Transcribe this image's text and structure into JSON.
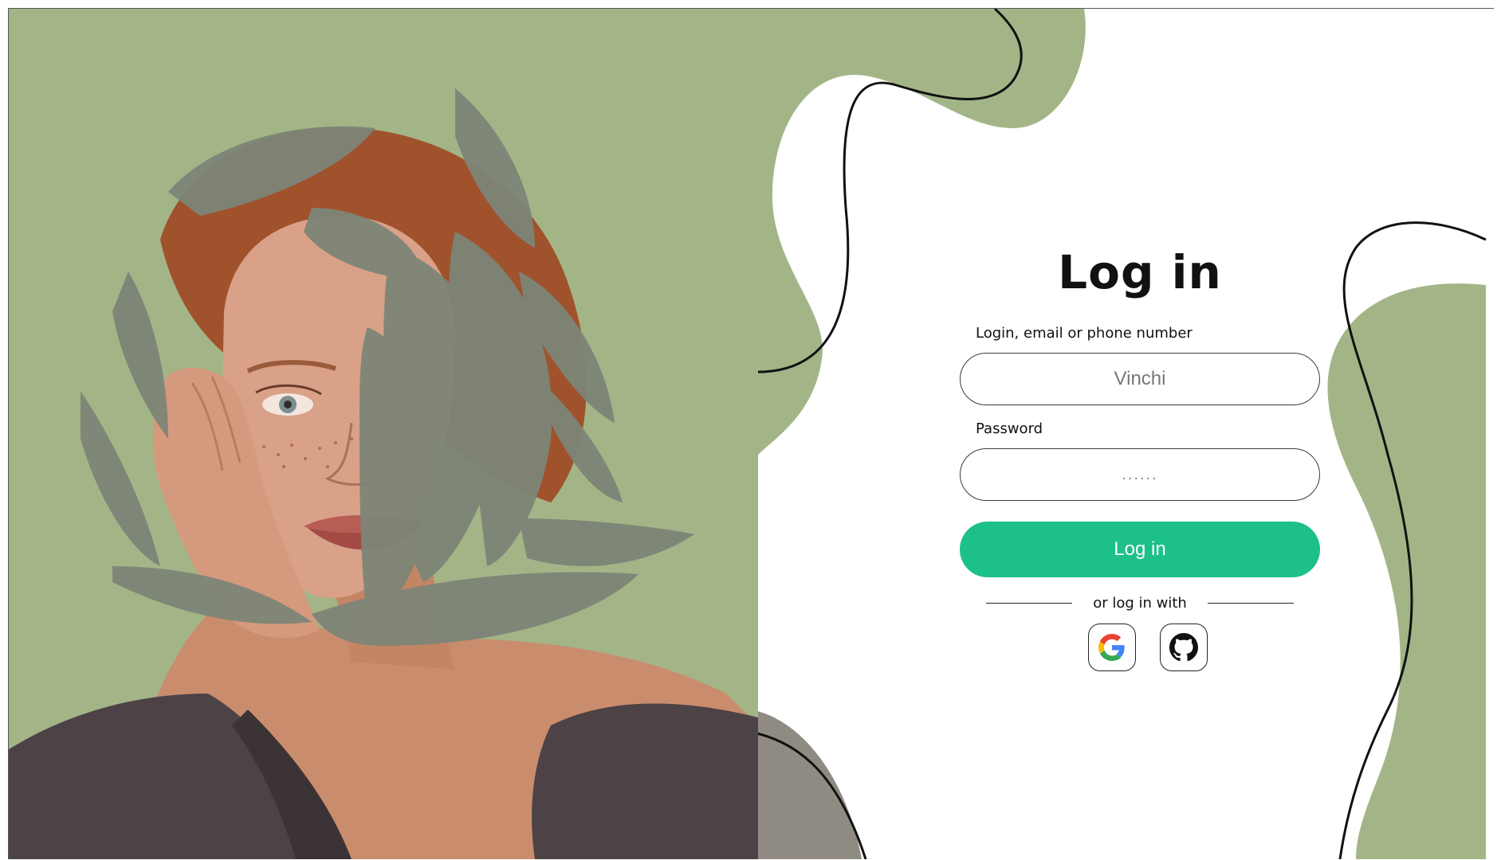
{
  "login_form": {
    "title": "Log in",
    "login_label": "Login, email or phone number",
    "login_value": "Vinchi",
    "password_label": "Password",
    "password_value": "......",
    "submit_label": "Log in",
    "alt_login_text": "or log in with",
    "social_providers": [
      {
        "name": "google-icon"
      },
      {
        "name": "github-icon"
      }
    ]
  },
  "colors": {
    "sage_green": "#a3b587",
    "submit_green": "#1dbf8a",
    "gray_blob": "#8f8b82",
    "text": "#111111"
  }
}
